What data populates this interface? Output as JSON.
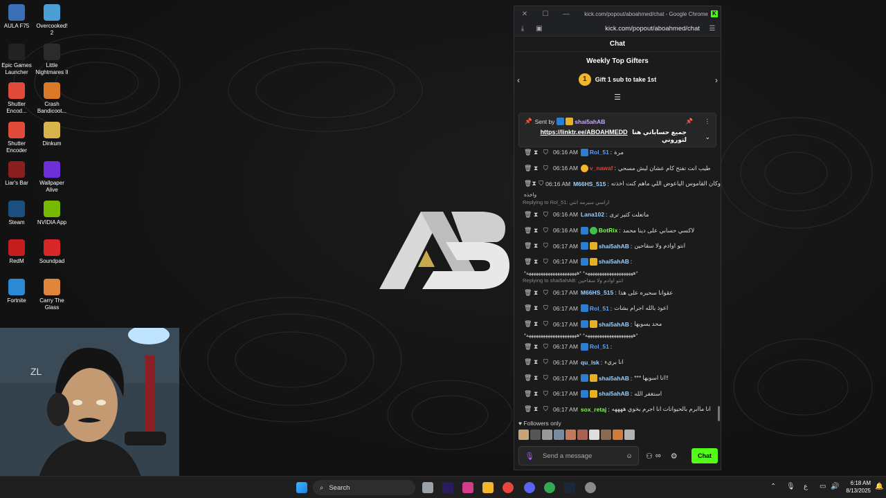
{
  "desktop_icons": [
    {
      "label": "AULA F75",
      "color": "#3a6fb5"
    },
    {
      "label": "Overcooked! 2",
      "color": "#4b9fd6"
    },
    {
      "label": "Epic Games Launcher",
      "color": "#222222"
    },
    {
      "label": "Little Nightmares II",
      "color": "#2b2b2b"
    },
    {
      "label": "Shutter Encod...",
      "color": "#e04a3a"
    },
    {
      "label": "Crash Bandicoot...",
      "color": "#d97a2a"
    },
    {
      "label": "Shutter Encoder",
      "color": "#e04a3a"
    },
    {
      "label": "Dinkum",
      "color": "#d8b24a"
    },
    {
      "label": "Liar's Bar",
      "color": "#8a1f1f"
    },
    {
      "label": "Wallpaper Alive",
      "color": "#6f2fd6"
    },
    {
      "label": "Steam",
      "color": "#1b4f80"
    },
    {
      "label": "NVIDIA App",
      "color": "#76b900"
    },
    {
      "label": "RedM",
      "color": "#c41e1e"
    },
    {
      "label": "Soundpad",
      "color": "#d62828"
    },
    {
      "label": "Fortnite",
      "color": "#2a8ad6"
    },
    {
      "label": "Carry The Glass",
      "color": "#e0853a"
    }
  ],
  "browser": {
    "title": "kick.com/popout/aboahmed/chat - Google Chrome",
    "kick_badge": "K",
    "url": "kick.com/popout/aboahmed/chat"
  },
  "chat": {
    "header": "Chat",
    "gifters_title": "Weekly Top Gifters",
    "gifter_rank": "1",
    "gifter_text": "Gift 1 sub to take 1st",
    "pinned": {
      "sent_by": "Sent by",
      "user": "shai5ahAB",
      "message_text": "جميع حساباتي هنا لتوروني",
      "link": "https://linktr.ee/ABOAHMEDD"
    },
    "messages": [
      {
        "time": "06:16 AM",
        "user": "Rol_51",
        "user_color": "#5aa0ff",
        "text": "مرة",
        "badges": [
          "b-blue"
        ]
      },
      {
        "time": "06:16 AM",
        "user": "v_nawaf",
        "user_color": "#e83a3a",
        "text": "طيب انت تفتح كام عشان ليش مسحي",
        "badges": [
          "b-medal"
        ]
      },
      {
        "time": "06:16 AM",
        "user": "M66HS_515",
        "user_color": "#9ad0ff",
        "text": "وكان القاموس الياعوض اللي ماهم كنت اخذته",
        "badges": [],
        "cont": "واخذه"
      },
      {
        "reply": "Replying to Rol_51: اراسي سيرمه انتي",
        "time": "06:16 AM",
        "user": "Lana102",
        "user_color": "#9ad0ff",
        "text": "ماتعلت كثير ترى",
        "badges": []
      },
      {
        "time": "06:16 AM",
        "user": "BotRix",
        "user_color": "#7cfc4a",
        "text": "لاكسي حسابي على دينا محمد",
        "badges": [
          "b-blue",
          "b-green"
        ]
      },
      {
        "time": "06:17 AM",
        "user": "shai5ahAB",
        "user_color": "#9ad0ff",
        "text": "انتو اوادم ولا سقاحين",
        "badges": [
          "b-blue",
          "b-gold"
        ]
      },
      {
        "time": "06:17 AM",
        "user": "shai5ahAB",
        "user_color": "#9ad0ff",
        "text": "",
        "badges": [
          "b-blue",
          "b-gold"
        ],
        "cont": "*ههههههههههههههههههههه* *هههههههههههههههههههههه*"
      },
      {
        "reply": "Replying to shai5ahAB: انتو اوادم ولا سقاحين",
        "time": "06:17 AM",
        "user": "M66HS_515",
        "user_color": "#9ad0ff",
        "text": "عقوانا سحيره على هذا",
        "badges": []
      },
      {
        "time": "06:17 AM",
        "user": "Rol_51",
        "user_color": "#5aa0ff",
        "text": "اعوذ بالله اجرام بشات",
        "badges": [
          "b-blue"
        ]
      },
      {
        "time": "06:17 AM",
        "user": "shai5ahAB",
        "user_color": "#9ad0ff",
        "text": "محد يسويها",
        "badges": [
          "b-blue",
          "b-gold"
        ],
        "cont": "*ههههههههههههههههههههه* *هههههههههههههههههههههه*"
      },
      {
        "time": "06:17 AM",
        "user": "Rol_51",
        "user_color": "#5aa0ff",
        "text": "",
        "badges": [
          "b-blue"
        ]
      },
      {
        "time": "06:17 AM",
        "user": "qu_lsk",
        "user_color": "#9ad0ff",
        "text": "انا بريء",
        "badges": []
      },
      {
        "time": "06:17 AM",
        "user": "shai5ahAB",
        "user_color": "#9ad0ff",
        "text": "*** انا اسويها!!",
        "badges": [
          "b-blue",
          "b-gold"
        ]
      },
      {
        "time": "06:17 AM",
        "user": "shai5ahAB",
        "user_color": "#9ad0ff",
        "text": "استغفر الله",
        "badges": [
          "b-blue",
          "b-gold"
        ]
      },
      {
        "time": "06:17 AM",
        "user": "sox_retaj",
        "user_color": "#7cfc4a",
        "text": "انا ماابرم بالحيوانات انا اجرم بخوي ههههه",
        "badges": []
      }
    ],
    "followers_label": "Followers only",
    "avatar_colors": [
      "#c9a27a",
      "#555",
      "#999",
      "#7a8aa0",
      "#c47a5a",
      "#aa6050",
      "#ddd",
      "#8a6a50",
      "#d27a3a",
      "#b2b2b2"
    ],
    "input_placeholder": "Send a message",
    "send_label": "Chat"
  },
  "taskbar": {
    "search_label": "Search",
    "time": "6:18 AM",
    "date": "8/13/2025",
    "lang": "ع"
  }
}
